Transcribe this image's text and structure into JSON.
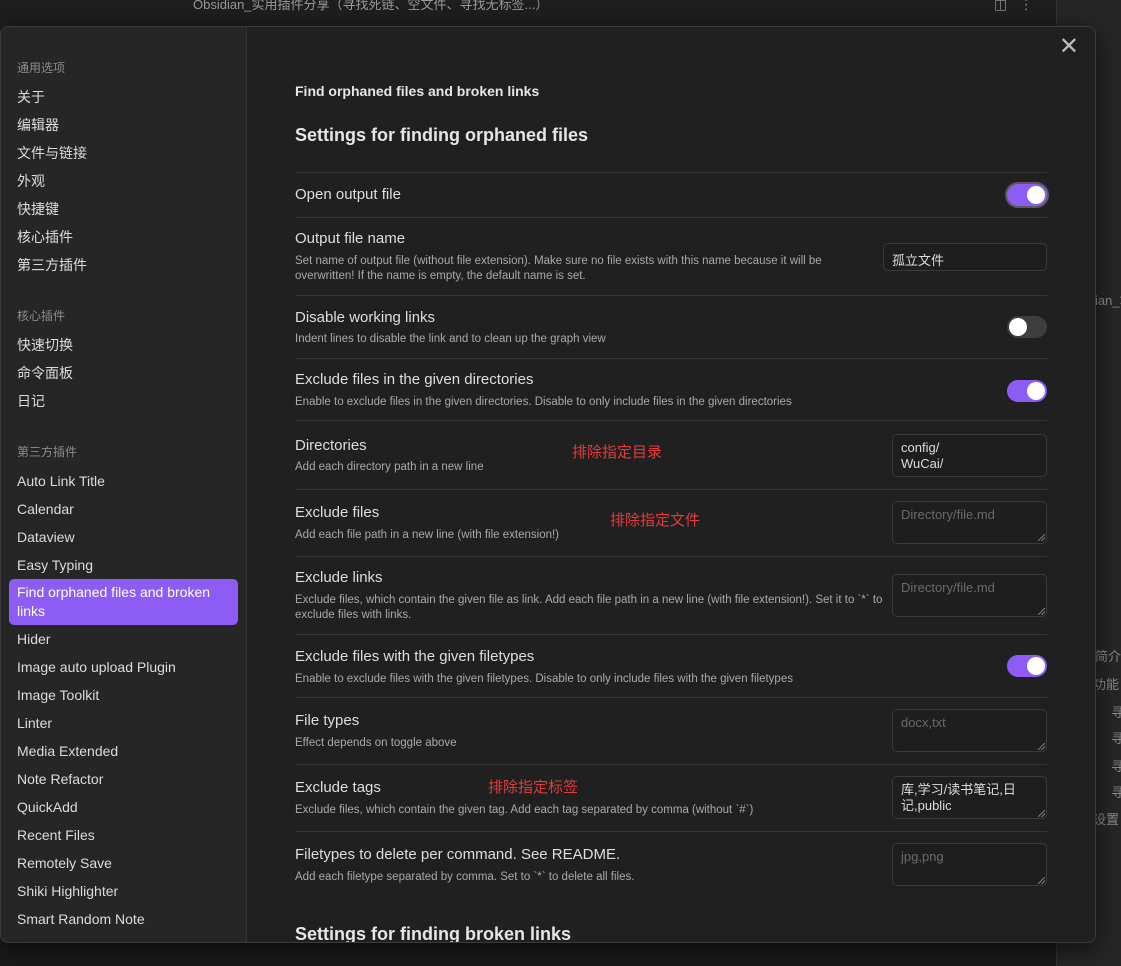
{
  "background": {
    "title": "Obsidian_实用插件分享（寻找死链、空文件、寻找无标签...）",
    "right_fragments": [
      "ian_笔",
      "简介",
      "功能",
      "寻",
      "寻",
      "寻",
      "寻",
      "设置"
    ]
  },
  "sidebar": {
    "group1_heading": "通用选项",
    "group1_items": [
      "关于",
      "编辑器",
      "文件与链接",
      "外观",
      "快捷键",
      "核心插件",
      "第三方插件"
    ],
    "group2_heading": "核心插件",
    "group2_items": [
      "快速切换",
      "命令面板",
      "日记"
    ],
    "group3_heading": "第三方插件",
    "group3_items": [
      "Auto Link Title",
      "Calendar",
      "Dataview",
      "Easy Typing",
      "Find orphaned files and broken links",
      "Hider",
      "Image auto upload Plugin",
      "Image Toolkit",
      "Linter",
      "Media Extended",
      "Note Refactor",
      "QuickAdd",
      "Recent Files",
      "Remotely Save",
      "Shiki Highlighter",
      "Smart Random Note"
    ],
    "active_item": "Find orphaned files and broken links"
  },
  "content": {
    "plugin_title": "Find orphaned files and broken links",
    "section1_title": "Settings for finding orphaned files",
    "section2_title": "Settings for finding broken links",
    "settings": {
      "open_output": {
        "name": "Open output file",
        "toggle": "on"
      },
      "output_name": {
        "name": "Output file name",
        "desc": "Set name of output file (without file extension). Make sure no file exists with this name because it will be overwritten! If the name is empty, the default name is set.",
        "value": "孤立文件"
      },
      "disable_links": {
        "name": "Disable working links",
        "desc": "Indent lines to disable the link and to clean up the graph view",
        "toggle": "off"
      },
      "exclude_dirs_toggle": {
        "name": "Exclude files in the given directories",
        "desc": "Enable to exclude files in the given directories. Disable to only include files in the given directories",
        "toggle": "on"
      },
      "directories": {
        "name": "Directories",
        "desc": "Add each directory path in a new line",
        "value": "config/\nWuCai/",
        "annotation": "排除指定目录"
      },
      "exclude_files": {
        "name": "Exclude files",
        "desc": "Add each file path in a new line (with file extension!)",
        "placeholder": "Directory/file.md",
        "annotation": "排除指定文件"
      },
      "exclude_links": {
        "name": "Exclude links",
        "desc": "Exclude files, which contain the given file as link. Add each file path in a new line (with file extension!). Set it to `*` to exclude files with links.",
        "placeholder": "Directory/file.md"
      },
      "exclude_filetypes_toggle": {
        "name": "Exclude files with the given filetypes",
        "desc": "Enable to exclude files with the given filetypes. Disable to only include files with the given filetypes",
        "toggle": "on"
      },
      "file_types": {
        "name": "File types",
        "desc": "Effect depends on toggle above",
        "placeholder": "docx,txt"
      },
      "exclude_tags": {
        "name": "Exclude tags",
        "desc": "Exclude files, which contain the given tag. Add each tag separated by comma (without `#`)",
        "value": "库,学习/读书笔记,日记,public",
        "annotation": "排除指定标签"
      },
      "filetypes_delete": {
        "name": "Filetypes to delete per command. See README.",
        "desc": "Add each filetype separated by comma. Set to `*` to delete all files.",
        "placeholder": "jpg,png"
      }
    }
  },
  "colors": {
    "accent": "#8c5cf5",
    "annotation": "#e03c3c",
    "background": "#202020",
    "sidebar": "#262626"
  },
  "icons": {
    "close": "close-icon"
  }
}
